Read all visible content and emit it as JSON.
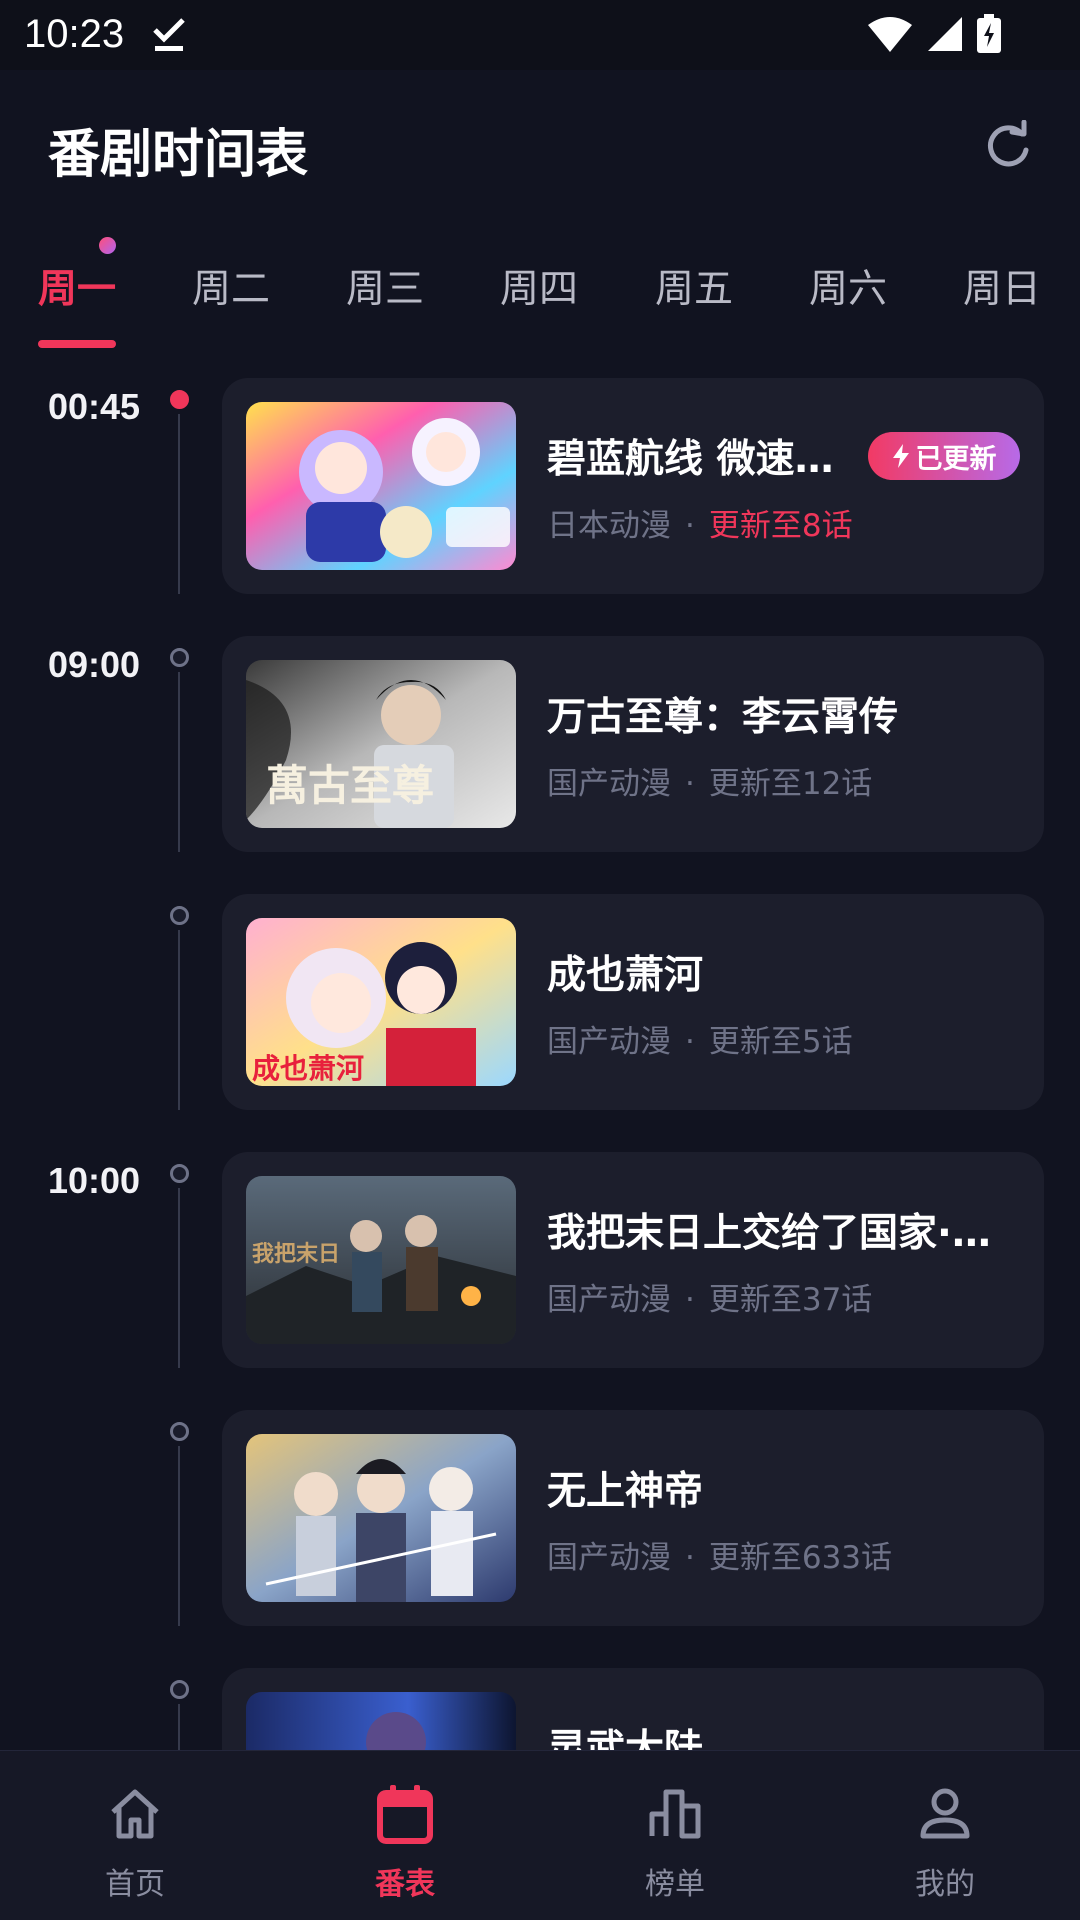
{
  "status_bar": {
    "time": "10:23"
  },
  "header": {
    "title": "番剧时间表",
    "refresh_icon": "refresh-icon"
  },
  "tabs": [
    {
      "label": "周一",
      "active": true
    },
    {
      "label": "周二"
    },
    {
      "label": "周三"
    },
    {
      "label": "周四"
    },
    {
      "label": "周五"
    },
    {
      "label": "周六"
    },
    {
      "label": "周日"
    }
  ],
  "schedule": [
    {
      "time": "00:45",
      "title": "碧蓝航线 微速…",
      "category": "日本动漫",
      "separator": "·",
      "episode": "更新至8话",
      "badge": "已更新",
      "current": true
    },
    {
      "time": "09:00",
      "title": "万古至尊：李云霄传",
      "category": "国产动漫",
      "separator": "·",
      "episode": "更新至12话"
    },
    {
      "time": "",
      "title": "成也萧河",
      "category": "国产动漫",
      "separator": "·",
      "episode": "更新至5话"
    },
    {
      "time": "10:00",
      "title": "我把末日上交给了国家·A…",
      "category": "国产动漫",
      "separator": "·",
      "episode": "更新至37话"
    },
    {
      "time": "",
      "title": "无上神帝",
      "category": "国产动漫",
      "separator": "·",
      "episode": "更新至633话"
    },
    {
      "time": "",
      "title": "灵武大陆",
      "category": "",
      "separator": "",
      "episode": ""
    }
  ],
  "bottom_nav": [
    {
      "label": "首页",
      "icon": "home-icon"
    },
    {
      "label": "番表",
      "icon": "calendar-icon",
      "active": true
    },
    {
      "label": "榜单",
      "icon": "chart-icon"
    },
    {
      "label": "我的",
      "icon": "person-icon"
    }
  ],
  "colors": {
    "accent": "#f0365a",
    "background": "#111320",
    "card": "#1c1e2c",
    "muted": "#6f7388"
  }
}
